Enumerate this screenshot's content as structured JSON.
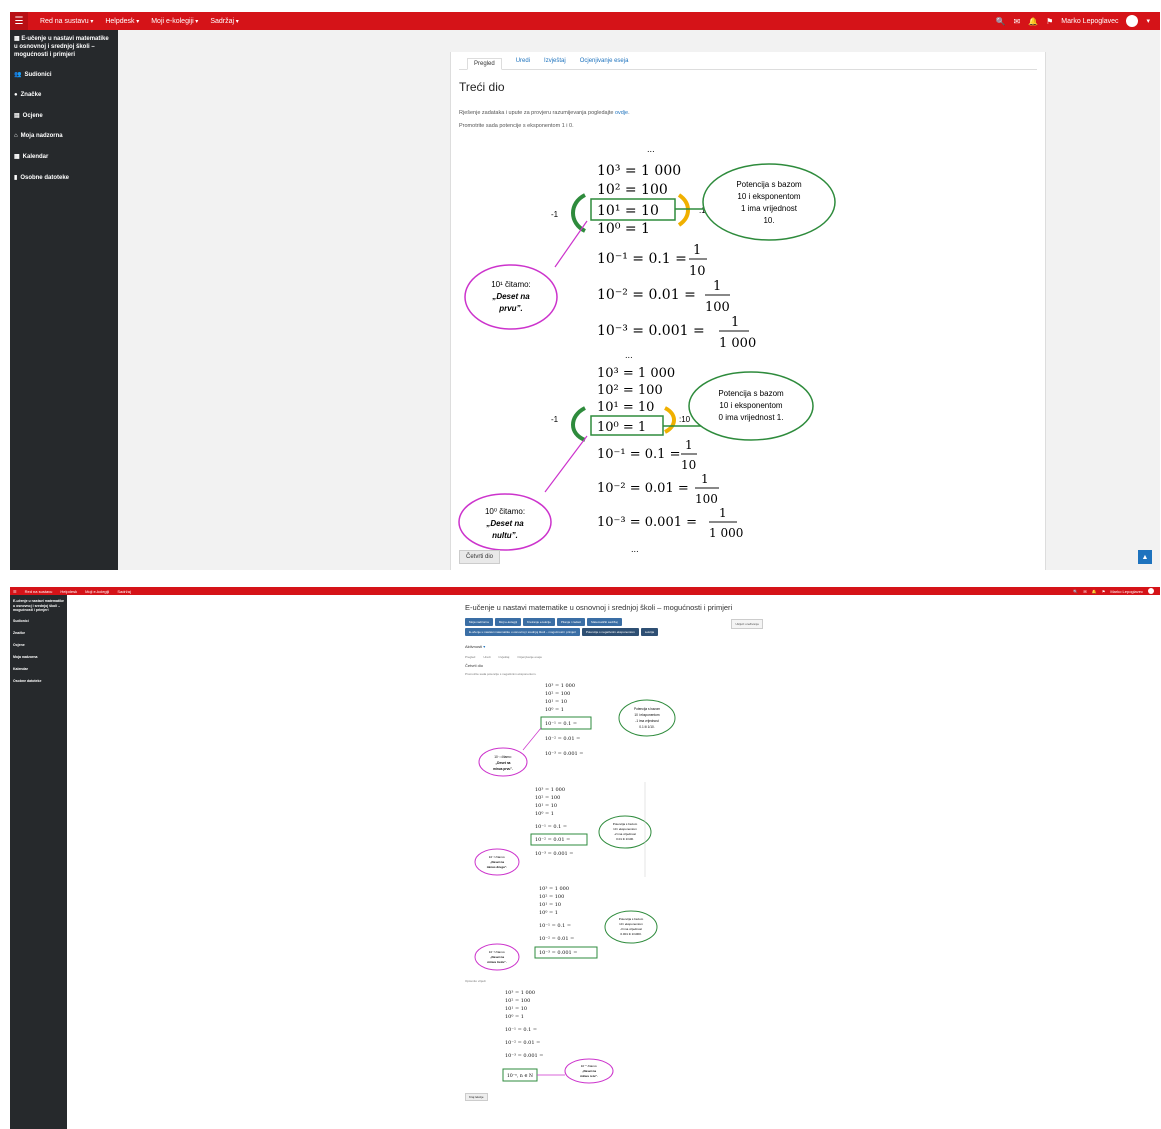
{
  "top": {
    "nav": {
      "home": "Red na sustavu",
      "helpdesk": "Helpdesk",
      "colleagues": "Moji e-kolegiji",
      "content": "Sadržaj",
      "user": "Marko Lepoglavec"
    },
    "sidebar": {
      "course": "E-učenje u nastavi matematike u osnovnoj i srednjoj školi – mogućnosti i primjeri",
      "items": [
        "Sudionici",
        "Značke",
        "Ocjene",
        "Moja nadzorna",
        "Kalendar",
        "Osobne datoteke"
      ]
    },
    "tabs": [
      "Pregled",
      "Uredi",
      "Izvještaj",
      "Ocjenjivanje eseja"
    ],
    "page_title": "Treći dio",
    "intro_text": "Rješenje zadataka i upute za provjeru razumijevanja pogledajte",
    "intro_link": "ovdje",
    "intro2": "Promotrite sada potencije s eksponentom 1 i 0.",
    "fig1": {
      "rows": [
        "10³ = 1 000",
        "10² = 100",
        "10¹ = 10",
        "10⁰ = 1",
        "10⁻¹ = 0.1 =",
        "10⁻² = 0.01 =",
        "10⁻³ = 0.001 ="
      ],
      "fracs": [
        [
          "1",
          "10"
        ],
        [
          "1",
          "100"
        ],
        [
          "1",
          "1 000"
        ]
      ],
      "minus": "-1",
      "colon": ":10",
      "cloud_green": [
        "Potencija s bazom",
        "10 i eksponentom",
        "1 ima vrijednost",
        "10."
      ],
      "cloud_pink": [
        "10¹ čitamo:",
        "„Deset na",
        "prvu”."
      ],
      "dots": "..."
    },
    "fig2": {
      "rows": [
        "10³ = 1 000",
        "10² = 100",
        "10¹ = 10",
        "10⁰ = 1",
        "10⁻¹ = 0.1 =",
        "10⁻² = 0.01 =",
        "10⁻³ = 0.001 ="
      ],
      "fracs": [
        [
          "1",
          "10"
        ],
        [
          "1",
          "100"
        ],
        [
          "1",
          "1 000"
        ]
      ],
      "minus": "-1",
      "colon": ":10",
      "cloud_green": [
        "Potencija s bazom",
        "10 i eksponentom",
        "0 ima vrijednost 1."
      ],
      "cloud_pink": [
        "10⁰ čitamo:",
        "„Deset na",
        "nultu”."
      ],
      "dots": "..."
    },
    "button": "Četvrti dio"
  },
  "bottom": {
    "nav": {
      "home": "Red na sustavu",
      "helpdesk": "Helpdesk",
      "colleagues": "Moji e-kolegiji",
      "content": "Sadržaj",
      "user": "Marko Lepoglavec"
    },
    "sidebar": {
      "course": "E-učenje u nastavi matematike u osnovnoj i srednjoj školi – mogućnosti i primjeri",
      "items": [
        "Sudionici",
        "Značke",
        "Ocjene",
        "Moja nadzorna",
        "Kalendar",
        "Osobne datoteke"
      ]
    },
    "course_title": "E-učenje u nastavi matematike u osnovnoj i srednjoj školi – mogućnosti i primjeri",
    "edit_btn": "Uključi uređivanje",
    "crumbs1": [
      "Moja nadzorna",
      "Moji e-kolegiji",
      "Kreiranje e-lekcije",
      "Pitanja i zadaci",
      "Matematički sadržaj"
    ],
    "crumbs2": [
      "E-učenje u nastavi matematike u osnovnoj i srednjoj školi – mogućnosti i primjeri",
      "Potencije s negativnim eksponentom",
      "Lekcija"
    ],
    "lesson_label": "Aktivnosti",
    "tabs": [
      "Pregled",
      "Uredi",
      "Izvještaj",
      "Ocjenjivanje eseja"
    ],
    "page_title": "Četvrti dio",
    "intro": "Promotrite sada potencije s negativnim eksponentom.",
    "section2": "Općenito vrijedi",
    "button": "Kraj lekcije",
    "fig_a": {
      "rows": [
        "10³ = 1 000",
        "10² = 100",
        "10¹ = 10",
        "10⁰ = 1",
        "10⁻¹ = 0.1 =",
        "10⁻² = 0.01 =",
        "10⁻³ = 0.001 ="
      ],
      "green": [
        "Potencija s bazom",
        "10 i eksponentom",
        "-1 ima vrijednost",
        "0.1 ili 1/10."
      ],
      "pink": [
        "10⁻¹ čitamo:",
        "„Deset na",
        "minus prvu”."
      ]
    },
    "fig_b": {
      "rows": [
        "10³ = 1 000",
        "10² = 100",
        "10¹ = 10",
        "10⁰ = 1",
        "10⁻¹ = 0.1 =",
        "10⁻² = 0.01 =",
        "10⁻³ = 0.001 ="
      ],
      "green": [
        "Potencija s bazom",
        "10 i eksponentom",
        "-2 ima vrijednost",
        "0.01 ili 1/100."
      ],
      "pink": [
        "10⁻² čitamo:",
        "„Deset na",
        "minus drugu”."
      ]
    },
    "fig_c": {
      "rows": [
        "10³ = 1 000",
        "10² = 100",
        "10¹ = 10",
        "10⁰ = 1",
        "10⁻¹ = 0.1 =",
        "10⁻² = 0.01 =",
        "10⁻³ = 0.001 ="
      ],
      "green": [
        "Potencija s bazom",
        "10 i eksponentom",
        "-3 ima vrijednost",
        "0.001 ili 1/1000."
      ],
      "pink": [
        "10⁻³ čitamo:",
        "„Deset na",
        "minus treću”."
      ]
    },
    "fig_d": {
      "rows": [
        "10³ = 1 000",
        "10² = 100",
        "10¹ = 10",
        "10⁰ = 1",
        "10⁻¹ = 0.1 =",
        "10⁻² = 0.01 =",
        "10⁻³ = 0.001 ="
      ],
      "box": "10⁻ⁿ, n ∈ N",
      "pink": [
        "10⁻ⁿ čitamo:",
        "„Deset na",
        "minus n-tu”."
      ]
    }
  }
}
